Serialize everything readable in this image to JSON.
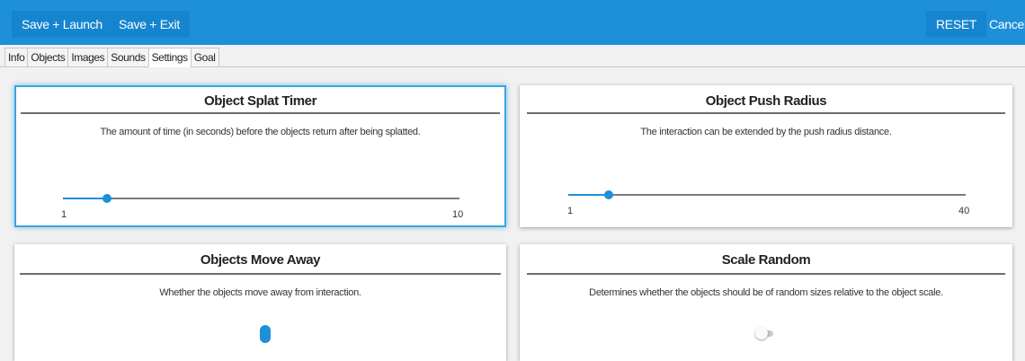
{
  "toolbar": {
    "save_launch": "Save + Launch",
    "save_exit": "Save + Exit",
    "reset": "RESET",
    "cancel": "Cancel",
    "color": "#1e8fd9"
  },
  "tabs": [
    {
      "label": "Info",
      "active": false
    },
    {
      "label": "Objects",
      "active": false
    },
    {
      "label": "Images",
      "active": false
    },
    {
      "label": "Sounds",
      "active": false
    },
    {
      "label": "Settings",
      "active": true
    },
    {
      "label": "Goal",
      "active": false
    }
  ],
  "settings": {
    "splat_timer": {
      "title": "Object Splat Timer",
      "description": "The amount of time (in seconds) before the objects return after being splatted.",
      "min": "1",
      "max": "10",
      "value": 2
    },
    "push_radius": {
      "title": "Object Push Radius",
      "description": "The interaction can be extended by the push radius distance.",
      "min": "1",
      "max": "40",
      "value": 5
    },
    "move_away": {
      "title": "Objects Move Away",
      "description": "Whether the objects move away from interaction.",
      "enabled": true
    },
    "scale_random": {
      "title": "Scale Random",
      "description": "Determines whether the objects should be of random sizes relative to the object scale.",
      "enabled": false
    }
  }
}
